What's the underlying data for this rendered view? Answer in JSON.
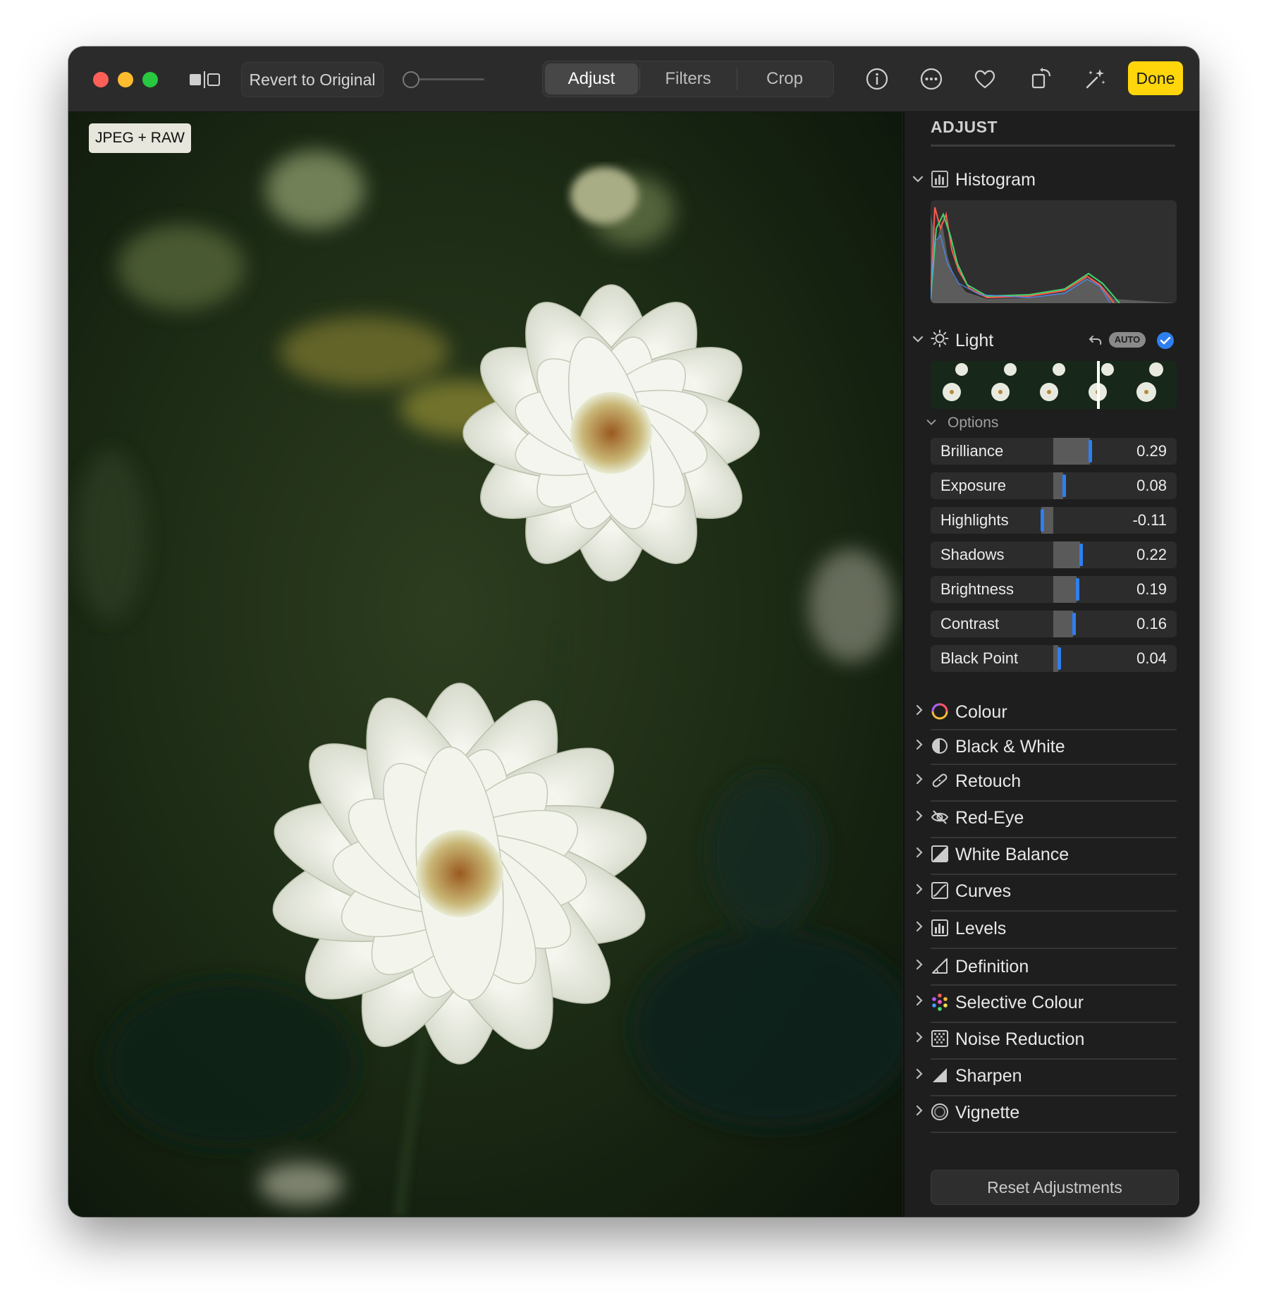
{
  "toolbar": {
    "revert_label": "Revert to Original",
    "tabs": [
      {
        "label": "Adjust",
        "selected": true
      },
      {
        "label": "Filters",
        "selected": false
      },
      {
        "label": "Crop",
        "selected": false
      }
    ],
    "icons": [
      "info-icon",
      "more-icon",
      "heart-icon",
      "rotate-icon",
      "magic-wand-icon"
    ],
    "done_label": "Done",
    "accent_color": "#ffd60a"
  },
  "photo": {
    "badge": "JPEG + RAW"
  },
  "sidebar": {
    "title": "ADJUST",
    "histogram": {
      "label": "Histogram",
      "expanded": true
    },
    "light": {
      "label": "Light",
      "auto_label": "AUTO",
      "enabled": true,
      "options_label": "Options",
      "sliders": [
        {
          "name": "Brilliance",
          "value": "0.29"
        },
        {
          "name": "Exposure",
          "value": "0.08"
        },
        {
          "name": "Highlights",
          "value": "-0.11"
        },
        {
          "name": "Shadows",
          "value": "0.22"
        },
        {
          "name": "Brightness",
          "value": "0.19"
        },
        {
          "name": "Contrast",
          "value": "0.16"
        },
        {
          "name": "Black Point",
          "value": "0.04"
        }
      ]
    },
    "sections": [
      {
        "label": "Colour",
        "icon": "colour-ring-icon"
      },
      {
        "label": "Black & White",
        "icon": "half-circle-icon"
      },
      {
        "label": "Retouch",
        "icon": "bandage-icon"
      },
      {
        "label": "Red-Eye",
        "icon": "eye-slash-icon"
      },
      {
        "label": "White Balance",
        "icon": "white-balance-icon"
      },
      {
        "label": "Curves",
        "icon": "curves-icon"
      },
      {
        "label": "Levels",
        "icon": "levels-icon"
      },
      {
        "label": "Definition",
        "icon": "definition-icon"
      },
      {
        "label": "Selective Colour",
        "icon": "colour-dots-icon"
      },
      {
        "label": "Noise Reduction",
        "icon": "noise-icon"
      },
      {
        "label": "Sharpen",
        "icon": "sharpen-icon"
      },
      {
        "label": "Vignette",
        "icon": "vignette-icon"
      }
    ],
    "reset_label": "Reset Adjustments",
    "slider_accent": "#2f7ff0"
  }
}
